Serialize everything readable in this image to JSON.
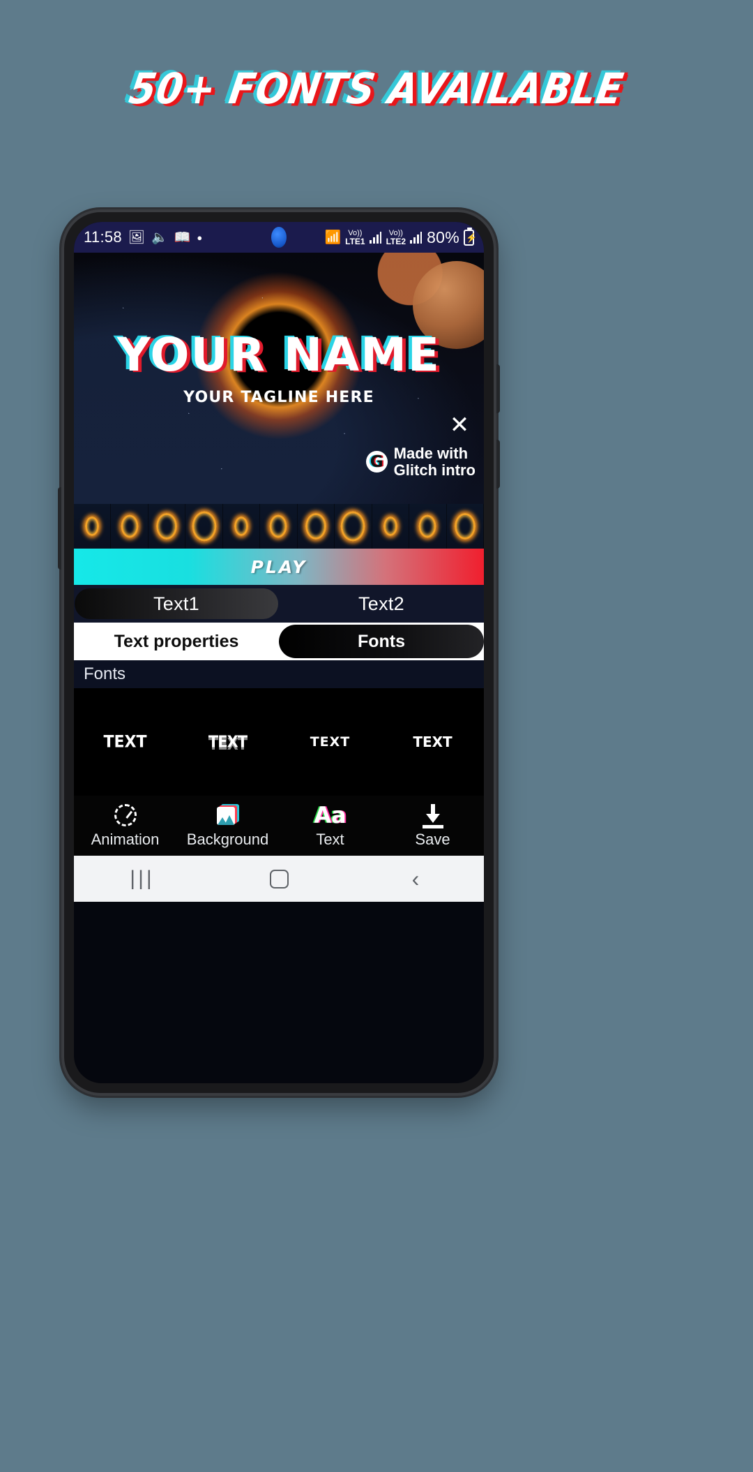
{
  "promo": {
    "headline": "50+ FONTS AVAILABLE"
  },
  "status_bar": {
    "clock": "11:58",
    "icons_left": [
      "image-icon",
      "volume-icon",
      "book-icon",
      "dot-icon"
    ],
    "wifi": "wifi-icon",
    "sim1_label_top": "Vo))",
    "sim1_label_bottom": "LTE1",
    "sim2_label_top": "Vo))",
    "sim2_label_bottom": "LTE2",
    "battery_percent": "80%",
    "battery_icon": "battery-charging-icon"
  },
  "preview": {
    "name_text": "YOUR NAME",
    "tagline_text": "YOUR TAGLINE HERE",
    "close_label": "✕",
    "watermark_logo": "G",
    "watermark_line1": "Made with",
    "watermark_line2": "Glitch intro",
    "glitch_red": "#e01a2b",
    "glitch_cyan": "#2ad4e6"
  },
  "timeline": {
    "frame_count": 11
  },
  "play_bar": {
    "label": "PLAY",
    "gradient_start": "#16e8e8",
    "gradient_end": "#f01f2e"
  },
  "text_tabs": {
    "items": [
      {
        "label": "Text1",
        "active": true
      },
      {
        "label": "Text2",
        "active": false
      }
    ]
  },
  "property_tabs": {
    "items": [
      {
        "label": "Text properties",
        "active": false
      },
      {
        "label": "Fonts",
        "active": true
      }
    ]
  },
  "fonts_panel": {
    "section_title": "Fonts",
    "samples": [
      {
        "label": "TEXT",
        "style": "fs-0"
      },
      {
        "label": "TEXT",
        "style": "fs-1"
      },
      {
        "label": "TEXT",
        "style": "fs-2"
      },
      {
        "label": "TEXT",
        "style": "fs-3"
      }
    ]
  },
  "app_nav": {
    "items": [
      {
        "label": "Animation",
        "icon": "animation-icon"
      },
      {
        "label": "Background",
        "icon": "background-icon"
      },
      {
        "label": "Text",
        "icon": "text-aa-icon"
      },
      {
        "label": "Save",
        "icon": "save-download-icon"
      }
    ]
  },
  "system_nav": {
    "recents": "|||",
    "home": "home-square-icon",
    "back": "‹"
  }
}
